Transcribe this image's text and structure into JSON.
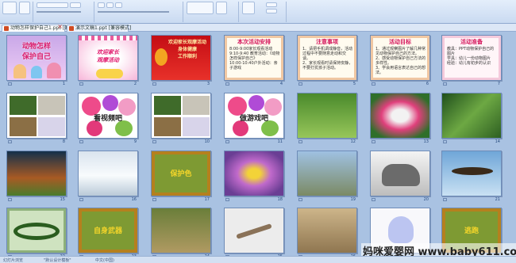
{
  "tabs": [
    {
      "label": "动物怎样保护自己1.ppt [兼容模式]"
    },
    {
      "label": "演示文稿1.ppt [兼容模式]"
    }
  ],
  "slides": [
    {
      "num": "1",
      "title": "动物怎样\n保护自己",
      "theme": "cartoon"
    },
    {
      "num": "2",
      "title": "欢迎家长\n观摩活动",
      "theme": "pink-welcome"
    },
    {
      "num": "3",
      "title": "欢迎家长观摩活动\n身体健康\n工作顺利",
      "theme": "red-greeting"
    },
    {
      "num": "4",
      "title": "本次活动安排",
      "body": "8:00-9:00家长观看活动\n9:10-9:40 教育活动：《动物怎样保护自己》\n10:00-10:40户外活动：亲子游戏",
      "theme": "paper"
    },
    {
      "num": "5",
      "title": "注意事项",
      "body": "1、请把手机调成静音，活动过程中不要随意走动和交谈。\n2、家长观看时请保持安静，不要打扰孩子活动。",
      "theme": "paper"
    },
    {
      "num": "6",
      "title": "活动目标",
      "body": "1、通过观察图片了解几种常见动物保护自己的方法。\n2、感受动物保护自己方法的多样性。\n3、学会用语言表达自己的想法。",
      "theme": "paper"
    },
    {
      "num": "7",
      "title": "活动准备",
      "body": "教具：PPT动物保护自己的图片\n学具：幼儿一份动物图片\n经验：幼儿有初步的认识",
      "theme": "paper-pink"
    },
    {
      "num": "8",
      "title": "",
      "theme": "animals-grid"
    },
    {
      "num": "9",
      "title": "看视频吧",
      "theme": "flowers"
    },
    {
      "num": "10",
      "title": "",
      "theme": "animals-grid"
    },
    {
      "num": "11",
      "title": "做游戏吧",
      "theme": "flowers"
    },
    {
      "num": "12",
      "title": "",
      "theme": "mantis"
    },
    {
      "num": "13",
      "title": "",
      "theme": "butterfly"
    },
    {
      "num": "14",
      "title": "",
      "theme": "leaf"
    },
    {
      "num": "15",
      "title": "",
      "theme": "coral"
    },
    {
      "num": "16",
      "title": "",
      "theme": "polar"
    },
    {
      "num": "17",
      "title": "保护色",
      "theme": "bamboo"
    },
    {
      "num": "18",
      "title": "",
      "theme": "hoverfly"
    },
    {
      "num": "19",
      "title": "",
      "theme": "goats"
    },
    {
      "num": "20",
      "title": "",
      "theme": "rhino"
    },
    {
      "num": "21",
      "title": "",
      "theme": "eagle"
    },
    {
      "num": "22",
      "title": "",
      "theme": "snake"
    },
    {
      "num": "23",
      "title": "自身武器",
      "theme": "bamboo"
    },
    {
      "num": "24",
      "title": "",
      "theme": "deer"
    },
    {
      "num": "25",
      "title": "",
      "theme": "lizard"
    },
    {
      "num": "26",
      "title": "",
      "theme": "meerkat"
    },
    {
      "num": "27",
      "title": "",
      "theme": "jelly"
    },
    {
      "num": "28",
      "title": "逃跑",
      "theme": "bamboo"
    }
  ],
  "status": {
    "left": "幻灯片浏览",
    "theme_label": "\"默认设计模板\"",
    "lang": "中文(中国)"
  },
  "watermark": "妈咪爱婴网 www.baby611.com"
}
